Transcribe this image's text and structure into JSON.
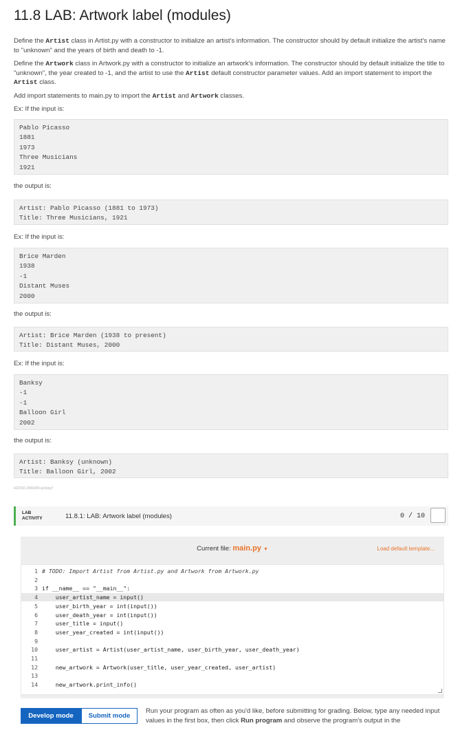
{
  "title": "11.8 LAB: Artwork label (modules)",
  "intro": {
    "p1": [
      "Define the ",
      "Artist",
      " class in Artist.py with a constructor to initialize an artist's information. The constructor should by default initialize the artist's name to \"unknown\" and the years of birth and death to -1."
    ],
    "p2": [
      "Define the ",
      "Artwork",
      " class in Artwork.py with a constructor to initialize an artwork's information. The constructor should by default initialize the title to \"unknown\", the year created to -1, and the artist to use the ",
      "Artist",
      " default constructor parameter values. Add an import statement to import the ",
      "Artist",
      " class."
    ],
    "p3": [
      "Add import statements to main.py to import the ",
      "Artist",
      " and ",
      "Artwork",
      " classes."
    ]
  },
  "examples": [
    {
      "input_label": "Ex: If the input is:",
      "input_lines": [
        "Pablo Picasso",
        "1881",
        "1973",
        "Three Musicians",
        "1921"
      ],
      "output_label": "the output is:",
      "output_lines": [
        "Artist: Pablo Picasso (1881 to 1973)",
        "Title: Three Musicians, 1921"
      ]
    },
    {
      "input_label": "Ex: If the input is:",
      "input_lines": [
        "Brice Marden",
        "1938",
        "-1",
        "Distant Muses",
        "2000"
      ],
      "output_label": "the output is:",
      "output_lines": [
        "Artist: Brice Marden (1938 to present)",
        "Title: Distant Muses, 2000"
      ]
    },
    {
      "input_label": "Ex: If the input is:",
      "input_lines": [
        "Banksy",
        "-1",
        "-1",
        "Balloon Girl",
        "2002"
      ],
      "output_label": "the output is:",
      "output_lines": [
        "Artist: Banksy (unknown)",
        "Title: Balloon Girl, 2002"
      ]
    }
  ],
  "small_id": "422342.2969394.qx3zqy7",
  "lab": {
    "tag_line1": "LAB",
    "tag_line2": "ACTIVITY",
    "title": "11.8.1: LAB: Artwork label (modules)",
    "score": "0 / 10"
  },
  "editor": {
    "current_file_label": "Current file:",
    "current_file": "main.py",
    "load_template": "Load default template...",
    "lines": [
      {
        "n": "1",
        "text": "# TODO: Import Artist from Artist.py and Artwork from Artwork.py",
        "comment": true
      },
      {
        "n": "2",
        "text": ""
      },
      {
        "n": "3",
        "text": "if __name__ == \"__main__\":"
      },
      {
        "n": "4",
        "text": "    user_artist_name = input()",
        "highlight": true
      },
      {
        "n": "5",
        "text": "    user_birth_year = int(input())"
      },
      {
        "n": "6",
        "text": "    user_death_year = int(input())"
      },
      {
        "n": "7",
        "text": "    user_title = input()"
      },
      {
        "n": "8",
        "text": "    user_year_created = int(input())"
      },
      {
        "n": "9",
        "text": ""
      },
      {
        "n": "10",
        "text": "    user_artist = Artist(user_artist_name, user_birth_year, user_death_year)"
      },
      {
        "n": "11",
        "text": ""
      },
      {
        "n": "12",
        "text": "    new_artwork = Artwork(user_title, user_year_created, user_artist)"
      },
      {
        "n": "13",
        "text": ""
      },
      {
        "n": "14",
        "text": "    new_artwork.print_info()"
      }
    ]
  },
  "buttons": {
    "develop": "Develop mode",
    "submit": "Submit mode"
  },
  "help": [
    "Run your program as often as you'd like, before submitting for grading. Below, type any needed input values in the first box, then click ",
    "Run program",
    " and observe the program's output in the"
  ]
}
